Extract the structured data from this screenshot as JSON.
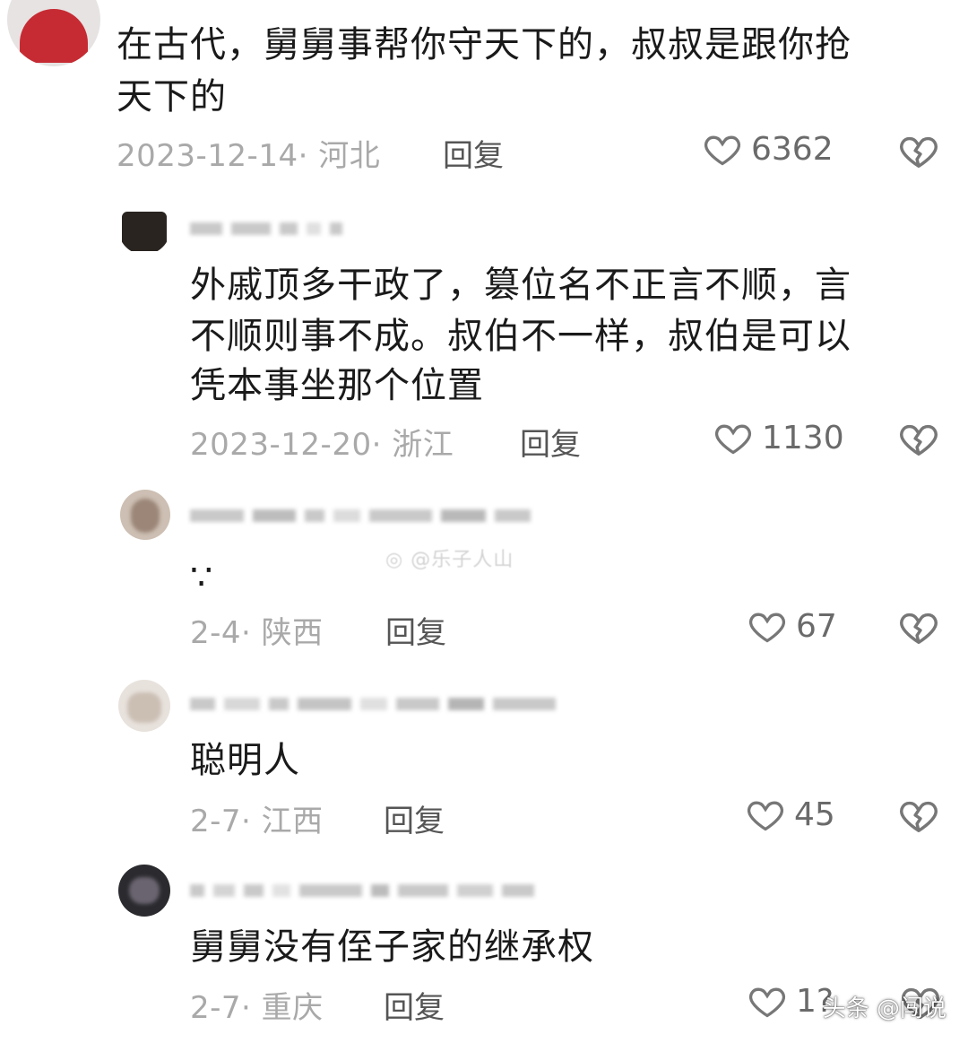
{
  "comments": [
    {
      "text_line1": "在古代，舅舅事帮你守天下的，叔叔是跟你抢",
      "text_line2": "天下的",
      "meta": "2023-12-14· 河北",
      "reply": "回复",
      "likes": "6362",
      "level": "top"
    },
    {
      "text_line1": "外戚顶多干政了，篡位名不正言不顺，言",
      "text_line2": "不顺则事不成。叔伯不一样，叔伯是可以",
      "text_line3": "凭本事坐那个位置",
      "meta": "2023-12-20· 浙江",
      "reply": "回复",
      "likes": "1130",
      "level": "reply"
    },
    {
      "text_line1": "∵",
      "meta": "2-4· 陕西",
      "reply": "回复",
      "likes": "67",
      "level": "reply"
    },
    {
      "text_line1": "聪明人",
      "meta": "2-7· 江西",
      "reply": "回复",
      "likes": "45",
      "level": "reply"
    },
    {
      "text_line1": "舅舅没有侄子家的继承权",
      "meta": "2-7· 重庆",
      "reply": "回复",
      "likes": "1?",
      "level": "reply"
    }
  ],
  "watermark": "@乐子人山",
  "brand": "头条 @闯说",
  "icons": {
    "like": "heart-outline-icon",
    "dislike": "broken-heart-icon"
  },
  "colors": {
    "meta_gray": "#a9a9a9",
    "text": "#1a1a1a"
  }
}
